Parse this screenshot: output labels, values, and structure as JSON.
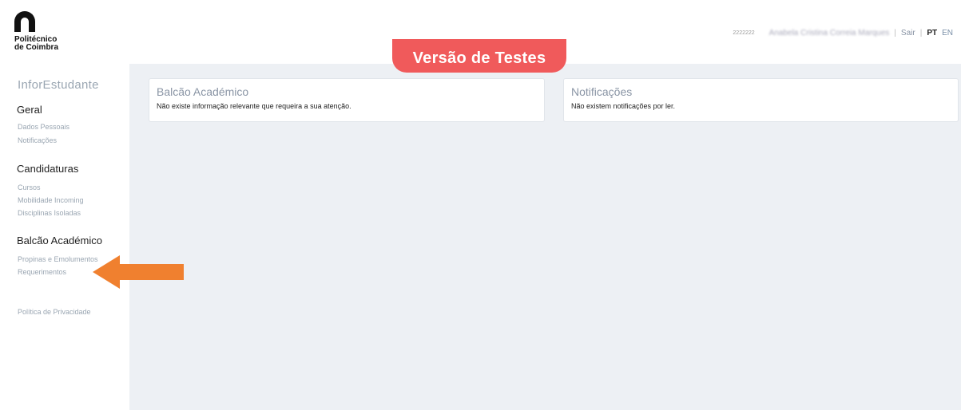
{
  "header": {
    "logo_line1": "Politécnico",
    "logo_line2": "de Coimbra",
    "test_banner": "Versão de Testes",
    "user_id": "2222222",
    "user_name": "Anabela Cristina Correia Marques",
    "logout": "Sair",
    "lang_pt": "PT",
    "lang_en": "EN"
  },
  "sidebar": {
    "brand": "InforEstudante",
    "sections": [
      {
        "title": "Geral",
        "items": [
          "Dados Pessoais",
          "Notificações"
        ]
      },
      {
        "title": "Candidaturas",
        "items": [
          "Cursos",
          "Mobilidade Incoming",
          "Disciplinas Isoladas"
        ]
      },
      {
        "title": "Balcão Académico",
        "items": [
          "Propinas e Emolumentos",
          "Requerimentos"
        ]
      }
    ],
    "privacy": "Política de Privacidade"
  },
  "main": {
    "cards": [
      {
        "title": "Balcão Académico",
        "body": "Não existe informação relevante que requeira a sua atenção."
      },
      {
        "title": "Notificações",
        "body": "Não existem notificações por ler."
      }
    ]
  },
  "colors": {
    "banner": "#f05a5b",
    "arrow": "#f0802f",
    "main_bg": "#edf0f4"
  }
}
